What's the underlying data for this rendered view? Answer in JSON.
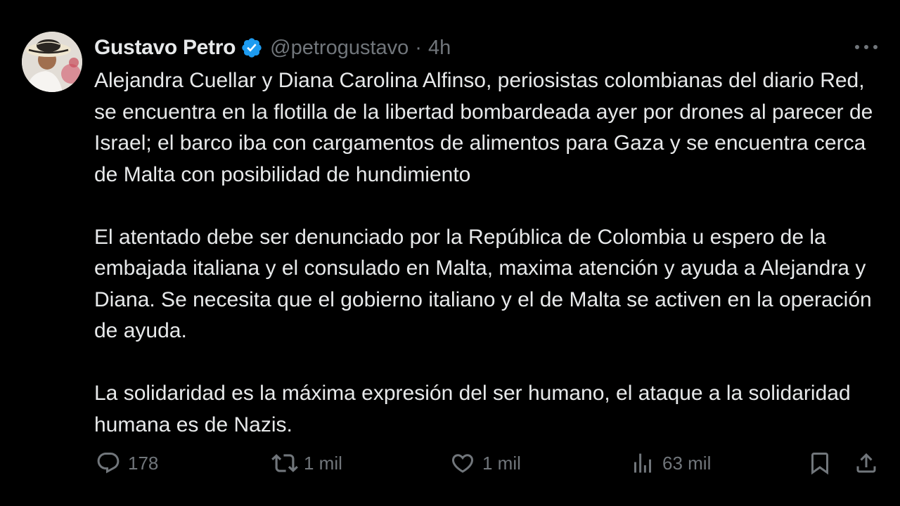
{
  "author": {
    "name": "Gustavo Petro",
    "handle": "@petrogustavo",
    "separator": "·",
    "time": "4h",
    "verified_color": "#1d9bf0"
  },
  "tweet": {
    "paragraphs": [
      "Alejandra Cuellar y Diana Carolina Alfinso, periosistas colombianas del diario Red, se encuentra en la flotilla de la libertad bombardeada ayer por drones al parecer de Israel; el barco iba con cargamentos de alimentos para Gaza y se encuentra cerca de Malta con posibilidad de hundimiento",
      "El atentado debe ser denunciado por la República de Colombia u espero de la embajada italiana y el consulado en Malta, maxima atención y ayuda a Alejandra y Diana. Se necesita que el gobierno italiano y el de Malta se activen en la operación de ayuda.",
      "La solidaridad es la máxima expresión del ser humano, el ataque a la solidaridad humana es de Nazis."
    ]
  },
  "actions": {
    "replies": {
      "icon": "reply-icon",
      "count": "178"
    },
    "reposts": {
      "icon": "repost-icon",
      "count": "1 mil"
    },
    "likes": {
      "icon": "heart-icon",
      "count": "1 mil"
    },
    "views": {
      "icon": "views-icon",
      "count": "63 mil"
    },
    "bookmark": {
      "icon": "bookmark-icon"
    },
    "share": {
      "icon": "share-icon"
    }
  },
  "menu": {
    "icon": "more-icon"
  },
  "colors": {
    "background": "#000000",
    "text_primary": "#e7e9ea",
    "text_secondary": "#71767b",
    "accent": "#1d9bf0"
  }
}
